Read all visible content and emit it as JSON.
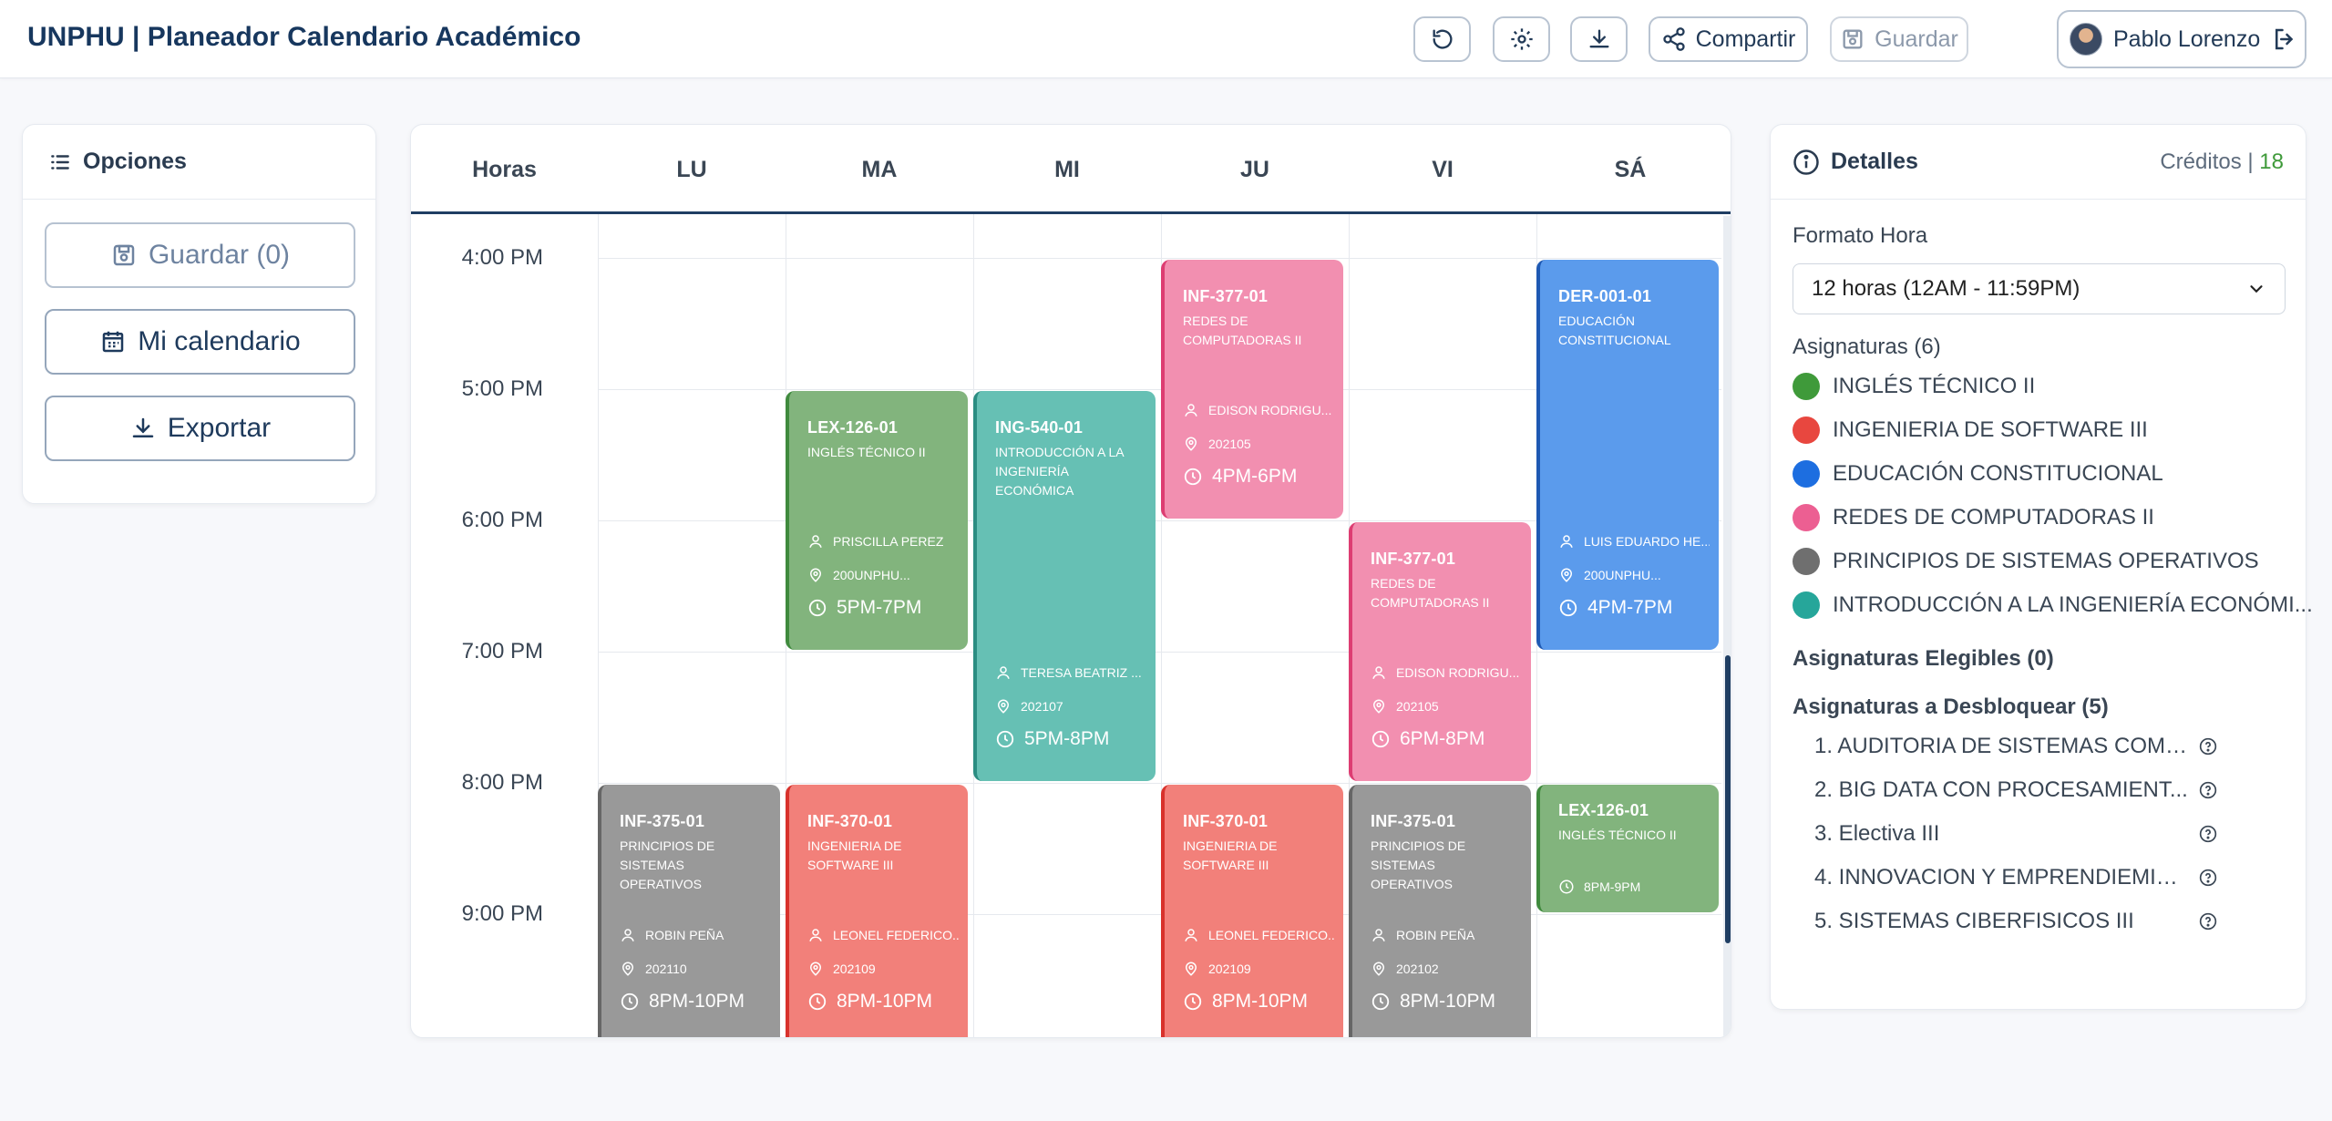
{
  "header": {
    "title": "UNPHU | Planeador Calendario Académico",
    "share_label": "Compartir",
    "save_label": "Guardar",
    "user_name": "Pablo Lorenzo"
  },
  "options": {
    "title": "Opciones",
    "save_label": "Guardar (0)",
    "calendar_label": "Mi calendario",
    "export_label": "Exportar"
  },
  "calendar": {
    "hours_header": "Horas",
    "days": [
      "LU",
      "MA",
      "MI",
      "JU",
      "VI",
      "SÁ"
    ],
    "hours": [
      "4:00 PM",
      "5:00 PM",
      "6:00 PM",
      "7:00 PM",
      "8:00 PM",
      "9:00 PM"
    ],
    "events": [
      {
        "code": "LEX-126-01",
        "name": "INGLÉS TÉCNICO II",
        "teacher": "PRISCILLA PEREZ",
        "room": "200UNPHU...",
        "time": "5PM-7PM",
        "color": "green"
      },
      {
        "code": "ING-540-01",
        "name": "INTRODUCCIÓN A LA INGENIERÍA ECONÓMICA",
        "teacher": "TERESA BEATRIZ ...",
        "room": "202107",
        "time": "5PM-8PM",
        "color": "teal"
      },
      {
        "code": "INF-377-01",
        "name": "REDES DE COMPUTADORAS II",
        "teacher": "EDISON RODRIGU...",
        "room": "202105",
        "time": "4PM-6PM",
        "color": "pink"
      },
      {
        "code": "DER-001-01",
        "name": "EDUCACIÓN CONSTITUCIONAL",
        "teacher": "LUIS EDUARDO HE...",
        "room": "200UNPHU...",
        "time": "4PM-7PM",
        "color": "blue"
      },
      {
        "code": "INF-377-01",
        "name": "REDES DE COMPUTADORAS II",
        "teacher": "EDISON RODRIGU...",
        "room": "202105",
        "time": "6PM-8PM",
        "color": "pink"
      },
      {
        "code": "INF-375-01",
        "name": "PRINCIPIOS DE SISTEMAS OPERATIVOS",
        "teacher": "ROBIN PEÑA",
        "room": "202110",
        "time": "8PM-10PM",
        "color": "gray"
      },
      {
        "code": "INF-370-01",
        "name": "INGENIERIA DE SOFTWARE III",
        "teacher": "LEONEL FEDERICO...",
        "room": "202109",
        "time": "8PM-10PM",
        "color": "red"
      },
      {
        "code": "INF-370-01",
        "name": "INGENIERIA DE SOFTWARE III",
        "teacher": "LEONEL FEDERICO...",
        "room": "202109",
        "time": "8PM-10PM",
        "color": "red"
      },
      {
        "code": "INF-375-01",
        "name": "PRINCIPIOS DE SISTEMAS OPERATIVOS",
        "teacher": "ROBIN PEÑA",
        "room": "202102",
        "time": "8PM-10PM",
        "color": "gray"
      },
      {
        "code": "LEX-126-01",
        "name": "INGLÉS TÉCNICO II",
        "time": "8PM-9PM",
        "color": "green"
      }
    ]
  },
  "details": {
    "title": "Detalles",
    "credits_label": "Créditos |",
    "credits_value": "18",
    "time_format_label": "Formato Hora",
    "time_format_value": "12 horas (12AM - 11:59PM)",
    "subjects_label": "Asignaturas (6)",
    "subjects": [
      {
        "name": "INGLÉS TÉCNICO II",
        "color": "#3f9a3a"
      },
      {
        "name": "INGENIERIA DE SOFTWARE III",
        "color": "#e8473f"
      },
      {
        "name": "EDUCACIÓN CONSTITUCIONAL",
        "color": "#1d6ee0"
      },
      {
        "name": "REDES DE COMPUTADORAS II",
        "color": "#ec5f92"
      },
      {
        "name": "PRINCIPIOS DE SISTEMAS OPERATIVOS",
        "color": "#6f6f6f"
      },
      {
        "name": "INTRODUCCIÓN A LA INGENIERÍA ECONÓMI...",
        "color": "#26a69a"
      }
    ],
    "eligible_label": "Asignaturas Elegibles (0)",
    "unlock_label": "Asignaturas a Desbloquear (5)",
    "unlock": [
      "1. AUDITORIA DE SISTEMAS COMP...",
      "2. BIG DATA CON PROCESAMIENT...",
      "3. Electiva III",
      "4. INNOVACION Y EMPRENDIEMIE...",
      "5. SISTEMAS CIBERFISICOS III"
    ]
  }
}
